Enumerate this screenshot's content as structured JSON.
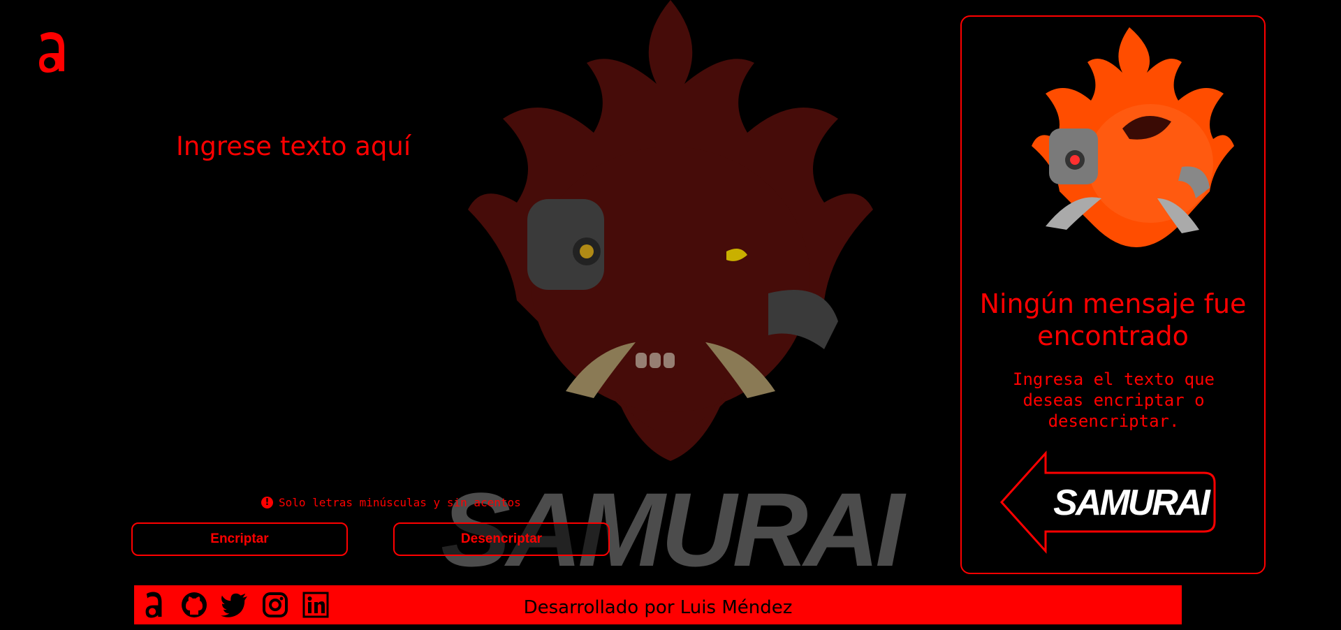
{
  "header": {
    "logo_icon": "alura-a-logo-icon"
  },
  "main": {
    "title": "Ingrese texto aquí",
    "textarea_value": "",
    "hint": "Solo letras minúsculas y sin acentos",
    "hint_icon": "exclamation-circle-icon",
    "buttons": {
      "encrypt": "Encriptar",
      "decrypt": "Desencriptar"
    },
    "background_art": "samurai-oni-mask-logo"
  },
  "output_panel": {
    "image": "samurai-oni-mask-logo",
    "title": "Ningún mensaje fue encontrado",
    "subtitle": "Ingresa el texto que deseas encriptar o desencriptar.",
    "brand_logo": "samurai-arrow-logo"
  },
  "footer": {
    "text": "Desarrollado por Luis Méndez",
    "icons": [
      "alura-icon",
      "github-icon",
      "twitter-icon",
      "instagram-icon",
      "linkedin-icon"
    ]
  },
  "colors": {
    "accent": "#ff0000",
    "background": "#000000",
    "mask_orange": "#ff4d00",
    "mask_dark": "#5a0f0c"
  }
}
